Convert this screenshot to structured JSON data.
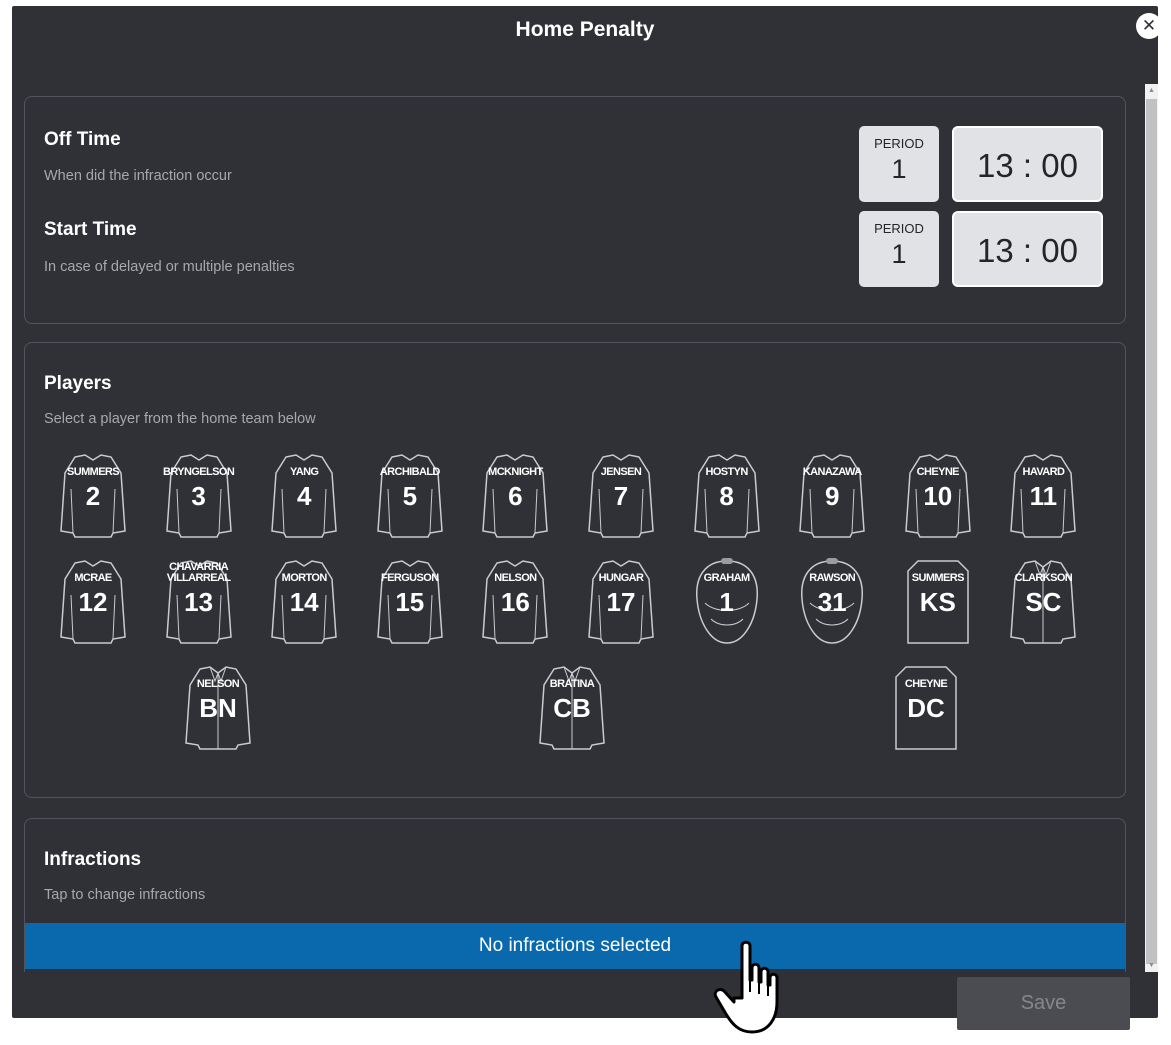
{
  "modal": {
    "title": "Home Penalty",
    "close_icon": "close-icon"
  },
  "off_time": {
    "title": "Off Time",
    "subtitle": "When did the infraction occur",
    "period_label": "PERIOD",
    "period": "1",
    "time": "13 : 00"
  },
  "start_time": {
    "title": "Start Time",
    "subtitle": "In case of delayed or multiple penalties",
    "period_label": "PERIOD",
    "period": "1",
    "time": "13 : 00"
  },
  "players": {
    "title": "Players",
    "subtitle": "Select a player from the home team below",
    "list": [
      {
        "name": "SUMMERS",
        "number": "2",
        "type": "jersey"
      },
      {
        "name": "BRYNGELSON",
        "number": "3",
        "type": "jersey"
      },
      {
        "name": "YANG",
        "number": "4",
        "type": "jersey"
      },
      {
        "name": "ARCHIBALD",
        "number": "5",
        "type": "jersey"
      },
      {
        "name": "MCKNIGHT",
        "number": "6",
        "type": "jersey"
      },
      {
        "name": "JENSEN",
        "number": "7",
        "type": "jersey"
      },
      {
        "name": "HOSTYN",
        "number": "8",
        "type": "jersey"
      },
      {
        "name": "KANAZAWA",
        "number": "9",
        "type": "jersey"
      },
      {
        "name": "CHEYNE",
        "number": "10",
        "type": "jersey"
      },
      {
        "name": "HAVARD",
        "number": "11",
        "type": "jersey"
      },
      {
        "name": "MCRAE",
        "number": "12",
        "type": "jersey"
      },
      {
        "name": "CHAVARRIA VILLARREAL",
        "number": "13",
        "type": "jersey"
      },
      {
        "name": "MORTON",
        "number": "14",
        "type": "jersey"
      },
      {
        "name": "FERGUSON",
        "number": "15",
        "type": "jersey"
      },
      {
        "name": "NELSON",
        "number": "16",
        "type": "jersey"
      },
      {
        "name": "HUNGAR",
        "number": "17",
        "type": "jersey"
      },
      {
        "name": "GRAHAM",
        "number": "1",
        "type": "goalie"
      },
      {
        "name": "RAWSON",
        "number": "31",
        "type": "goalie"
      },
      {
        "name": "SUMMERS",
        "number": "KS",
        "type": "staff"
      },
      {
        "name": "CLARKSON",
        "number": "SC",
        "type": "coach"
      },
      {
        "name": "NELSON",
        "number": "BN",
        "type": "coach"
      },
      {
        "name": "BRATINA",
        "number": "CB",
        "type": "coach"
      },
      {
        "name": "CHEYNE",
        "number": "DC",
        "type": "staff"
      }
    ]
  },
  "infractions": {
    "title": "Infractions",
    "subtitle": "Tap to change infractions",
    "selected_text": "No infractions selected"
  },
  "save_label": "Save",
  "colors": {
    "background": "#2f3136",
    "accent": "#0a68ad",
    "panel": "#e0e2e5"
  }
}
